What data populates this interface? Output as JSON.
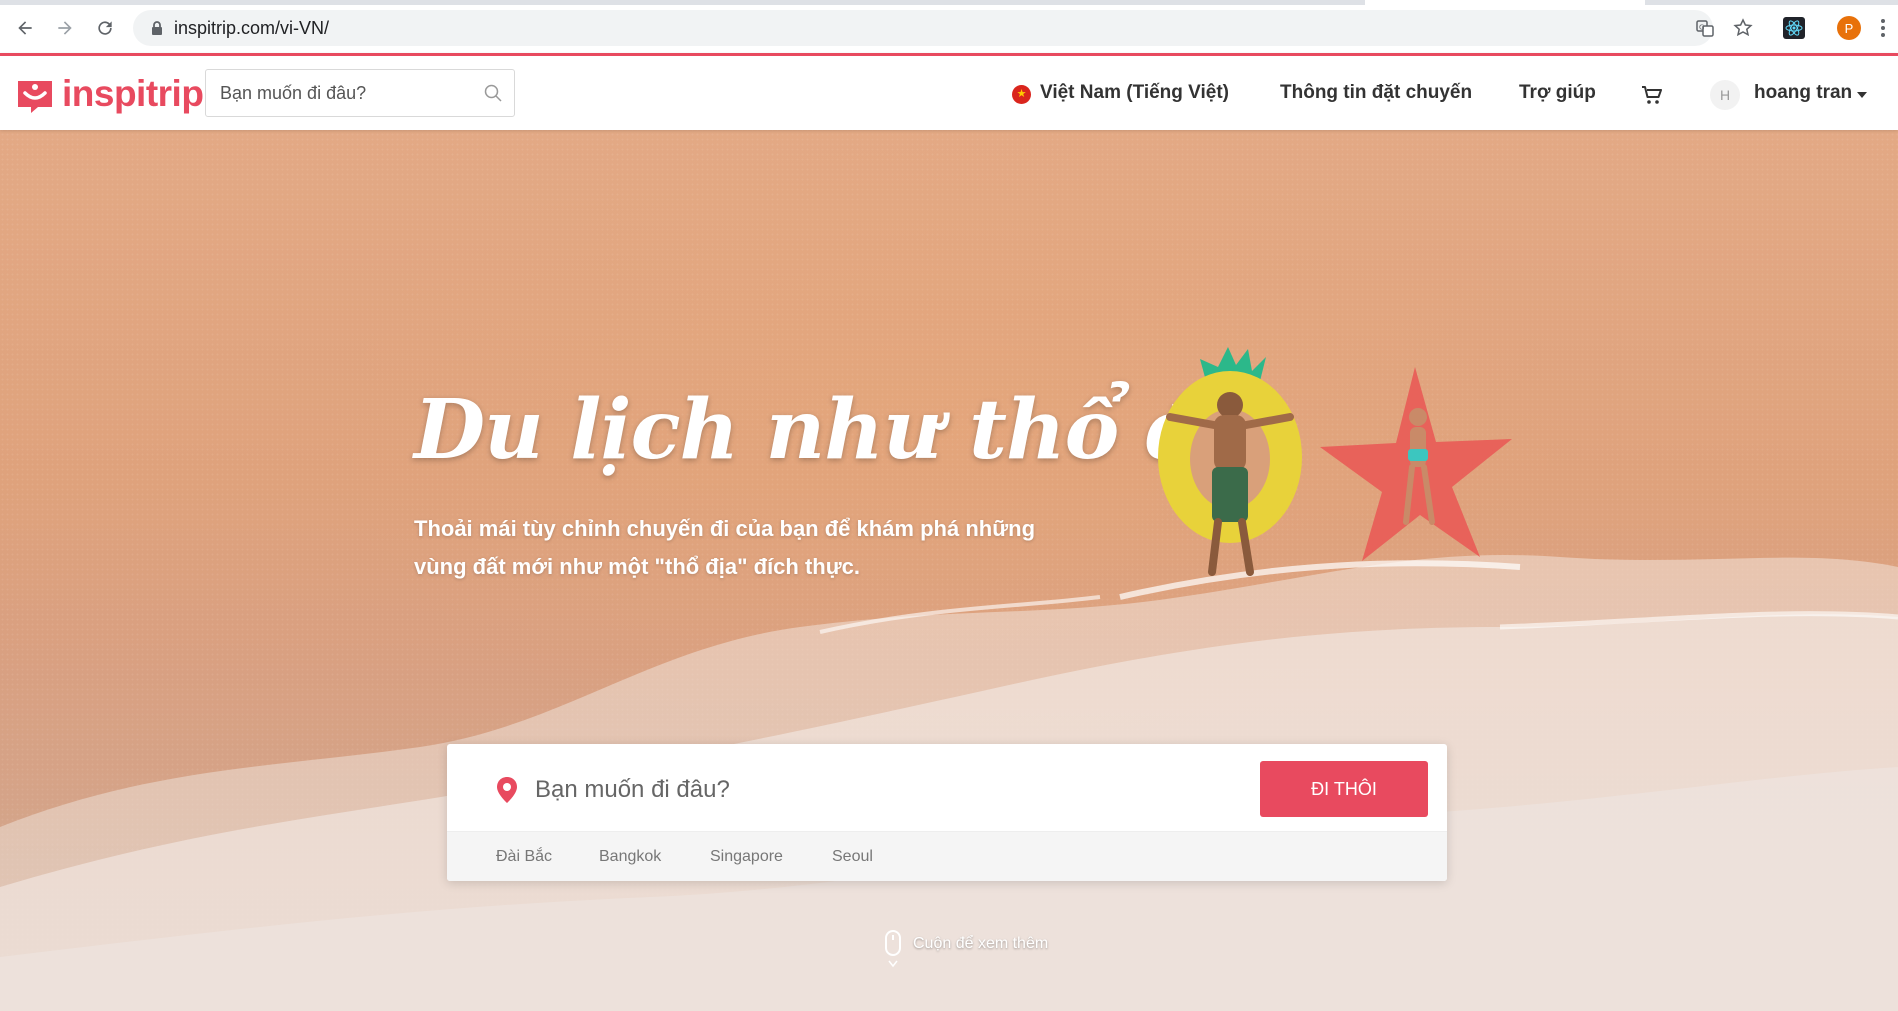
{
  "browser": {
    "url": "inspitrip.com/vi-VN/",
    "profile_initial": "P"
  },
  "header": {
    "logo_text": "inspitrip",
    "search_placeholder": "Bạn muốn đi đâu?",
    "locale_label": "Việt Nam (Tiếng Việt)",
    "booking_info_label": "Thông tin đặt chuyến",
    "help_label": "Trợ giúp",
    "user_initial": "H",
    "user_name": "hoang tran",
    "brand_color": "#e84a5f"
  },
  "hero": {
    "title": "Du lịch như thổ địa",
    "subtitle": "Thoải mái tùy chỉnh chuyến đi của bạn để khám phá những vùng đất mới như một \"thổ địa\" đích thực.",
    "search_placeholder": "Bạn muốn đi đâu?",
    "go_button_label": "ĐI THÔI",
    "suggestions": [
      "Đài Bắc",
      "Bangkok",
      "Singapore",
      "Seoul"
    ],
    "scroll_hint": "Cuộn để xem thêm"
  },
  "icons": {
    "back": "back-arrow-icon",
    "forward": "forward-arrow-icon",
    "reload": "reload-icon",
    "lock": "lock-icon",
    "translate": "translate-icon",
    "bookmark": "star-icon",
    "extension": "react-devtools-icon",
    "menu": "kebab-menu-icon",
    "search": "search-icon",
    "flag": "vietnam-flag-icon",
    "cart": "cart-icon",
    "pin": "location-pin-icon",
    "mouse": "mouse-scroll-icon"
  }
}
